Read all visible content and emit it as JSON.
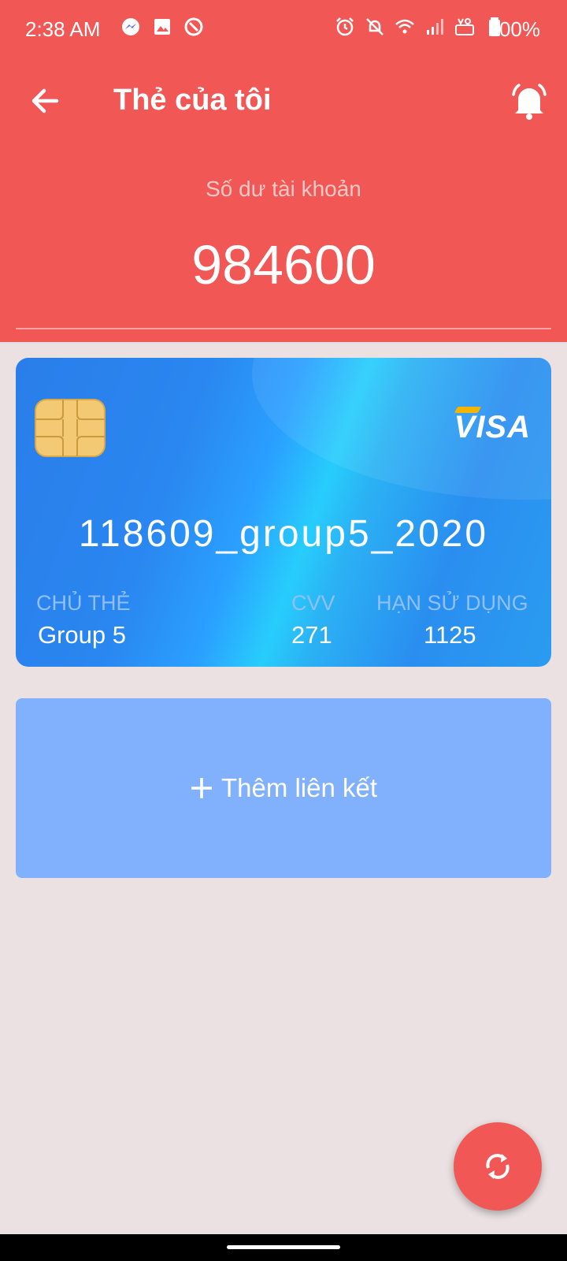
{
  "status_bar": {
    "time": "2:38 AM",
    "battery": "100%",
    "left_icons": [
      "messenger-icon",
      "image-icon",
      "data-saver-icon"
    ],
    "right_icons": [
      "alarm-icon",
      "notifications-off-icon",
      "wifi-icon",
      "signal-icon",
      "volte-icon",
      "battery-icon"
    ]
  },
  "toolbar": {
    "title": "Thẻ của tôi",
    "back_icon": "arrow-left-icon",
    "bell_icon": "notification-bell-icon"
  },
  "balance": {
    "label": "Số dư tài khoản",
    "value": "984600"
  },
  "card": {
    "brand": "VISA",
    "number": "118609_group5_2020",
    "holder_label": "CHỦ THẺ",
    "holder": "Group 5",
    "cvv_label": "CVV",
    "cvv": "271",
    "expiry_label": "HẠN SỬ DỤNG",
    "expiry": "1125"
  },
  "add_link": {
    "label": "Thêm liên kết",
    "icon": "plus-icon"
  },
  "fab": {
    "icon": "refresh-icon"
  },
  "colors": {
    "header": "#f15755",
    "background": "#ebe1e2",
    "add_link": "#81b0fd",
    "card_blue": "#2a86f0"
  }
}
